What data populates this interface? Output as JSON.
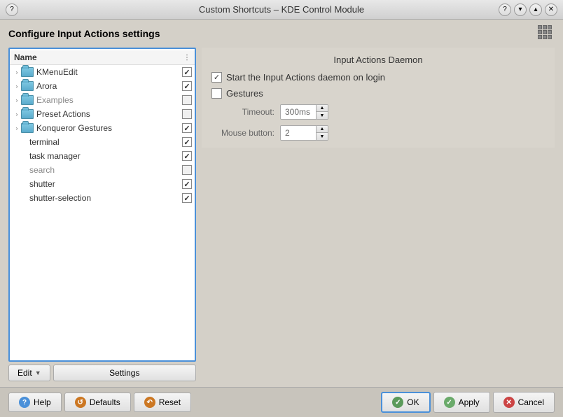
{
  "titlebar": {
    "title": "Custom Shortcuts – KDE Control Module",
    "btn_help": "?",
    "btn_min": "▼",
    "btn_max": "▲",
    "btn_close": "✕"
  },
  "page": {
    "title": "Configure Input Actions settings"
  },
  "tree": {
    "header_name": "Name",
    "items": [
      {
        "id": "kmenuEdit",
        "label": "KMenuEdit",
        "type": "folder",
        "checked": true,
        "expanded": true,
        "indent": 0
      },
      {
        "id": "arora",
        "label": "Arora",
        "type": "folder",
        "checked": true,
        "expanded": true,
        "indent": 0
      },
      {
        "id": "examples",
        "label": "Examples",
        "type": "folder",
        "checked": false,
        "dimmed": true,
        "expanded": true,
        "indent": 0
      },
      {
        "id": "presetActions",
        "label": "Preset Actions",
        "type": "folder",
        "checked": false,
        "expanded": true,
        "indent": 0
      },
      {
        "id": "konquerorGestures",
        "label": "Konqueror Gestures",
        "type": "folder",
        "checked": true,
        "expanded": true,
        "indent": 0
      },
      {
        "id": "terminal",
        "label": "terminal",
        "type": "item",
        "checked": true,
        "indent": 1
      },
      {
        "id": "taskManager",
        "label": "task manager",
        "type": "item",
        "checked": true,
        "indent": 1
      },
      {
        "id": "search",
        "label": "search",
        "type": "item",
        "checked": false,
        "dimmed": true,
        "indent": 1
      },
      {
        "id": "shutter",
        "label": "shutter",
        "type": "item",
        "checked": true,
        "indent": 1
      },
      {
        "id": "shutterSelection",
        "label": "shutter-selection",
        "type": "item",
        "checked": true,
        "indent": 1
      }
    ]
  },
  "left_buttons": {
    "edit_label": "Edit",
    "settings_label": "Settings"
  },
  "right_panel": {
    "daemon_title": "Input Actions Daemon",
    "start_daemon_label": "Start the Input Actions daemon on login",
    "gestures_label": "Gestures",
    "timeout_label": "Timeout:",
    "timeout_value": "300ms",
    "mouse_button_label": "Mouse button:",
    "mouse_button_value": "2"
  },
  "bottom_buttons": {
    "help_label": "Help",
    "defaults_label": "Defaults",
    "reset_label": "Reset",
    "ok_label": "OK",
    "apply_label": "Apply",
    "cancel_label": "Cancel"
  }
}
